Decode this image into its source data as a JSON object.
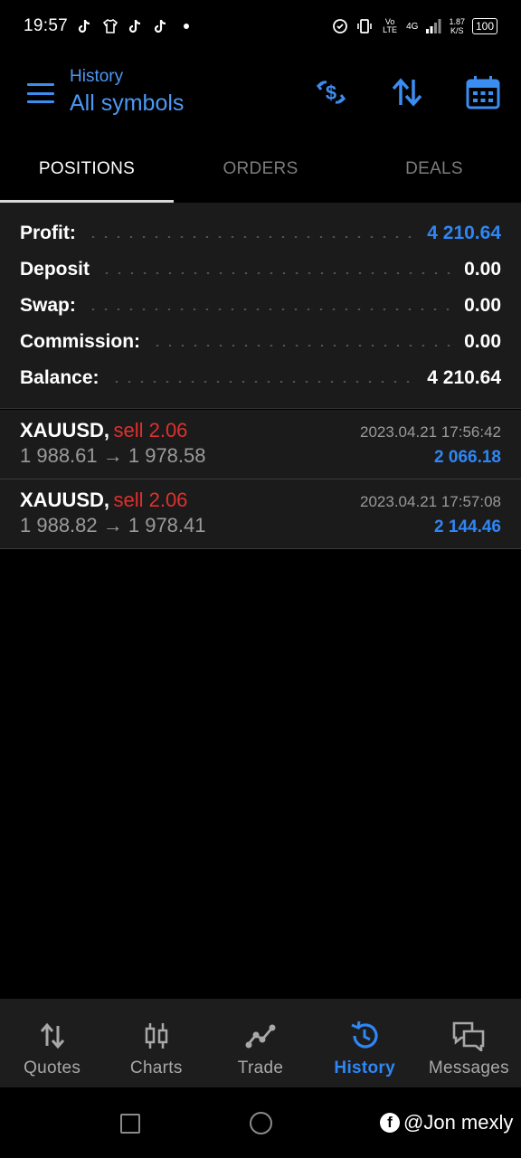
{
  "status_bar": {
    "time": "19:57",
    "network": "4G",
    "lte": "Vo LTE",
    "speed_value": "1.87",
    "speed_unit": "K/S",
    "battery": "100"
  },
  "header": {
    "subtitle": "History",
    "title": "All symbols",
    "icons": [
      "currency-exchange-icon",
      "sort-arrows-icon",
      "calendar-icon"
    ]
  },
  "tabs": [
    {
      "label": "POSITIONS",
      "active": true
    },
    {
      "label": "ORDERS",
      "active": false
    },
    {
      "label": "DEALS",
      "active": false
    }
  ],
  "summary": {
    "profit_label": "Profit:",
    "profit_value": "4 210.64",
    "deposit_label": "Deposit",
    "deposit_value": "0.00",
    "swap_label": "Swap:",
    "swap_value": "0.00",
    "commission_label": "Commission:",
    "commission_value": "0.00",
    "balance_label": "Balance:",
    "balance_value": "4 210.64"
  },
  "positions": [
    {
      "symbol": "XAUUSD,",
      "side": "sell 2.06",
      "datetime": "2023.04.21 17:56:42",
      "prices": "1 988.61 → 1 978.58",
      "profit": "2 066.18"
    },
    {
      "symbol": "XAUUSD,",
      "side": "sell 2.06",
      "datetime": "2023.04.21 17:57:08",
      "prices": "1 988.82 → 1 978.41",
      "profit": "2 144.46"
    }
  ],
  "bottom_nav": [
    {
      "label": "Quotes",
      "icon": "quotes-arrows-icon",
      "active": false
    },
    {
      "label": "Charts",
      "icon": "candlestick-icon",
      "active": false
    },
    {
      "label": "Trade",
      "icon": "trade-line-icon",
      "active": false
    },
    {
      "label": "History",
      "icon": "history-clock-icon",
      "active": true
    },
    {
      "label": "Messages",
      "icon": "messages-chat-icon",
      "active": false
    }
  ],
  "watermark": "@Jon mexly",
  "colors": {
    "accent": "#2f86f5",
    "sell": "#e0302e",
    "panel": "#1b1b1b"
  }
}
